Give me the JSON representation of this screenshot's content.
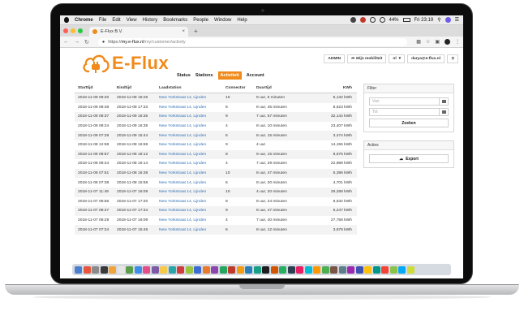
{
  "menubar": {
    "app": "Chrome",
    "items": [
      "File",
      "Edit",
      "View",
      "History",
      "Bookmarks",
      "People",
      "Window",
      "Help"
    ],
    "battery": "44%",
    "clock": "Fri 23:19"
  },
  "browser": {
    "tab_title": "E-Flux B.V.",
    "tab_close": "×",
    "new_tab": "+",
    "url_prefix": "https://",
    "url_host": "my.e-flux.nl",
    "url_path": "/my/customer/activity"
  },
  "header": {
    "logo_text": "E-Flux",
    "nav": [
      "Status",
      "Stations",
      "Activiteit",
      "Account"
    ],
    "active_nav": "Activiteit",
    "admin_label": "ADMIN",
    "mobility_label": "Mijn mobiliteit",
    "lang_label": "nl",
    "user_label": "darya@e-flux.nl"
  },
  "table": {
    "headers": [
      "Starttijd",
      "Eindtijd",
      "Laadstation",
      "Connector",
      "Duurtijd",
      "KWh"
    ],
    "rows": [
      [
        "2018-11-09 09:20",
        "2018-11-09 18:25",
        "New Yorkstraat 14, Lijnden",
        "10",
        "9 uur, 5 minuten",
        "5,132 kWh"
      ],
      [
        "2018-11-09 08:48",
        "2018-11-09 17:33",
        "New Yorkstraat 14, Lijnden",
        "8",
        "8 uur, 45 minuten",
        "8,623 kWh"
      ],
      [
        "2018-11-09 08:37",
        "2018-11-09 16:35",
        "New Yorkstraat 14, Lijnden",
        "9",
        "7 uur, 57 minuten",
        "32,144 kWh"
      ],
      [
        "2018-11-09 08:24",
        "2018-11-09 16:35",
        "New Yorkstraat 14, Lijnden",
        "4",
        "8 uur, 10 minuten",
        "23,407 kWh"
      ],
      [
        "2018-11-09 07:29",
        "2018-11-09 15:44",
        "New Yorkstraat 14, Lijnden",
        "6",
        "8 uur, 15 minuten",
        "3,474 kWh"
      ],
      [
        "2018-11-08 12:58",
        "2018-11-08 16:59",
        "New Yorkstraat 14, Lijnden",
        "9",
        "4 uur",
        "14,155 kWh"
      ],
      [
        "2018-11-08 08:57",
        "2018-11-08 18:12",
        "New Yorkstraat 14, Lijnden",
        "8",
        "9 uur, 15 minuten",
        "8,675 kWh"
      ],
      [
        "2018-11-08 08:44",
        "2018-11-08 16:14",
        "New Yorkstraat 14, Lijnden",
        "4",
        "7 uur, 29 minuten",
        "22,988 kWh"
      ],
      [
        "2018-11-08 07:51",
        "2018-11-08 16:38",
        "New Yorkstraat 14, Lijnden",
        "10",
        "8 uur, 47 minuten",
        "5,396 kWh"
      ],
      [
        "2018-11-08 07:38",
        "2018-11-08 15:58",
        "New Yorkstraat 14, Lijnden",
        "6",
        "8 uur, 20 minuten",
        "4,701 kWh"
      ],
      [
        "2018-11-07 11:49",
        "2018-11-07 16:09",
        "New Yorkstraat 14, Lijnden",
        "10",
        "4 uur, 20 minuten",
        "29,288 kWh"
      ],
      [
        "2018-11-07 08:56",
        "2018-11-07 17:20",
        "New Yorkstraat 14, Lijnden",
        "8",
        "8 uur, 24 minuten",
        "8,532 kWh"
      ],
      [
        "2018-11-07 08:47",
        "2018-11-07 17:34",
        "New Yorkstraat 14, Lijnden",
        "9",
        "8 uur, 47 minuten",
        "5,247 kWh"
      ],
      [
        "2018-11-07 08:29",
        "2018-11-07 16:09",
        "New Yorkstraat 14, Lijnden",
        "4",
        "7 uur, 40 minuten",
        "27,756 kWh"
      ],
      [
        "2018-11-07 07:34",
        "2018-11-07 15:46",
        "New Yorkstraat 14, Lijnden",
        "6",
        "8 uur, 12 minuten",
        "3,679 kWh"
      ]
    ]
  },
  "filter": {
    "title": "Filter",
    "from_placeholder": "Van",
    "to_placeholder": "Tot",
    "search_label": "Zoeken"
  },
  "actions": {
    "title": "Acties",
    "export_label": "Export"
  },
  "colors": {
    "brand": "#f08a1a",
    "link": "#2e6fb7"
  }
}
